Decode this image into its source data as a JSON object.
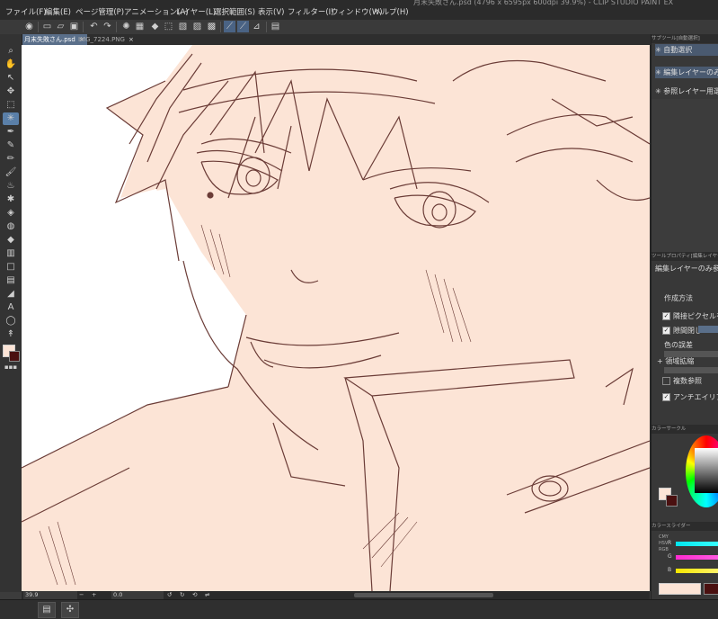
{
  "title": "月末失敗さん.psd (4796 x 6595px 600dpi 39.9%) - CLIP STUDIO PAINT EX",
  "menu": [
    "ファイル(F)",
    "編集(E)",
    "ページ管理(P)",
    "アニメーション(A)",
    "レイヤー(L)",
    "選択範囲(S)",
    "表示(V)",
    "フィルター(I)",
    "ウィンドウ(W)",
    "ヘルプ(H)"
  ],
  "tabs": [
    {
      "label": "月末失敗さん.psd",
      "active": true
    },
    {
      "label": "IMG_7224.PNG",
      "active": false
    }
  ],
  "tab_close_glyph": "×",
  "status": {
    "zoom": "39.9",
    "angle": "0.0",
    "minus": "−",
    "plus": "+"
  },
  "subtool_panel": {
    "header": "サブツール[自動選択]",
    "items": [
      {
        "label": "自動選択",
        "selected": true
      },
      {
        "label": "編集レイヤーのみ参照",
        "selected": true
      },
      {
        "label": "参照レイヤー用選択",
        "selected": false
      }
    ]
  },
  "tool_property": {
    "header": "ツールプロパティ[編集レイヤーのみ参照]",
    "subtitle": "編集レイヤーのみ参照選択",
    "section": "作成方法",
    "checks": [
      {
        "label": "隣接ピクセルをたどる",
        "checked": true
      },
      {
        "label": "隙間閉じ",
        "checked": true
      },
      {
        "label": "色の誤差",
        "checked": null
      },
      {
        "label": "領域拡縮",
        "checked": null
      },
      {
        "label": "複数参照",
        "checked": false
      },
      {
        "label": "アンチエイリアス",
        "checked": true
      }
    ]
  },
  "color_circle": {
    "header": "カラーサークル"
  },
  "color_slider": {
    "header": "カラースライダー",
    "channels": [
      "R",
      "G",
      "B"
    ],
    "modes": [
      "RGB",
      "HSV",
      "CMY"
    ]
  },
  "colors": {
    "main": "#fce4d6",
    "sub": "#4a1010",
    "line": "#6b3c37",
    "skin": "#fce4d6"
  }
}
